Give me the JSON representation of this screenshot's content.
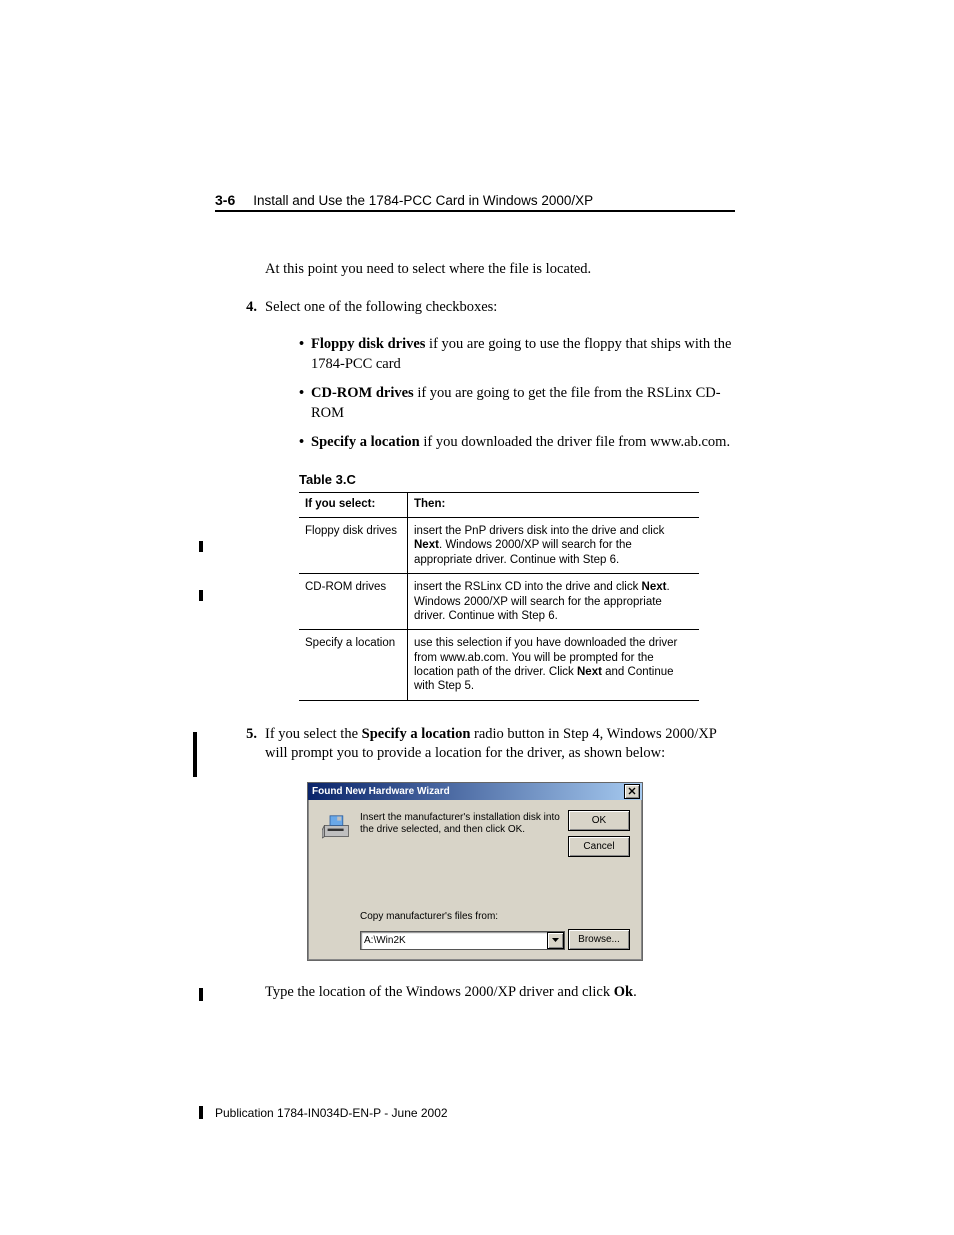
{
  "header": {
    "page_num": "3-6",
    "title": "Install and Use the 1784-PCC Card in Windows 2000/XP"
  },
  "intro": "At this point you need to select where the file is located.",
  "step4": {
    "num": "4.",
    "text": "Select one of the following checkboxes:"
  },
  "bullets": [
    {
      "bold": "Floppy disk drives",
      "rest": " if you are going to use the floppy that ships with the 1784-PCC card"
    },
    {
      "bold": "CD-ROM drives",
      "rest": " if you are going to get the file from the RSLinx CD-ROM"
    },
    {
      "bold": "Specify a location",
      "rest": " if you downloaded the driver file from www.ab.com."
    }
  ],
  "table": {
    "caption": "Table 3.C",
    "h1": "If you select:",
    "h2": "Then:",
    "rows": [
      {
        "c1": "Floppy disk drives",
        "c2a": "insert the PnP drivers disk into the drive and click ",
        "c2b": "Next",
        "c2c": ". Windows 2000/XP will search for the appropriate driver. Continue with Step 6."
      },
      {
        "c1": "CD-ROM drives",
        "c2a": "insert the RSLinx CD into the drive and click ",
        "c2b": "Next",
        "c2c": ". Windows 2000/XP will search for the appropriate driver. Continue with Step 6."
      },
      {
        "c1": "Specify a location",
        "c2a": "use this selection if you have downloaded the driver from www.ab.com. You will be prompted for the location path of the driver. Click ",
        "c2b": "Next",
        "c2c": " and Continue with Step 5."
      }
    ]
  },
  "step5": {
    "num": "5.",
    "pre": "If you select the ",
    "bold": "Specify a location",
    "post": " radio button in Step 4, Windows 2000/XP will prompt you to provide a location for the driver, as shown below:"
  },
  "dialog": {
    "title": "Found New Hardware Wizard",
    "msg": "Insert the manufacturer's installation disk into the drive selected, and then click OK.",
    "ok": "OK",
    "cancel": "Cancel",
    "label": "Copy manufacturer's files from:",
    "path": "A:\\Win2K",
    "browse": "Browse..."
  },
  "closing": {
    "pre": "Type the location of the Windows 2000/XP driver and click ",
    "bold": "Ok",
    "post": "."
  },
  "footer": "Publication 1784-IN034D-EN-P - June 2002"
}
